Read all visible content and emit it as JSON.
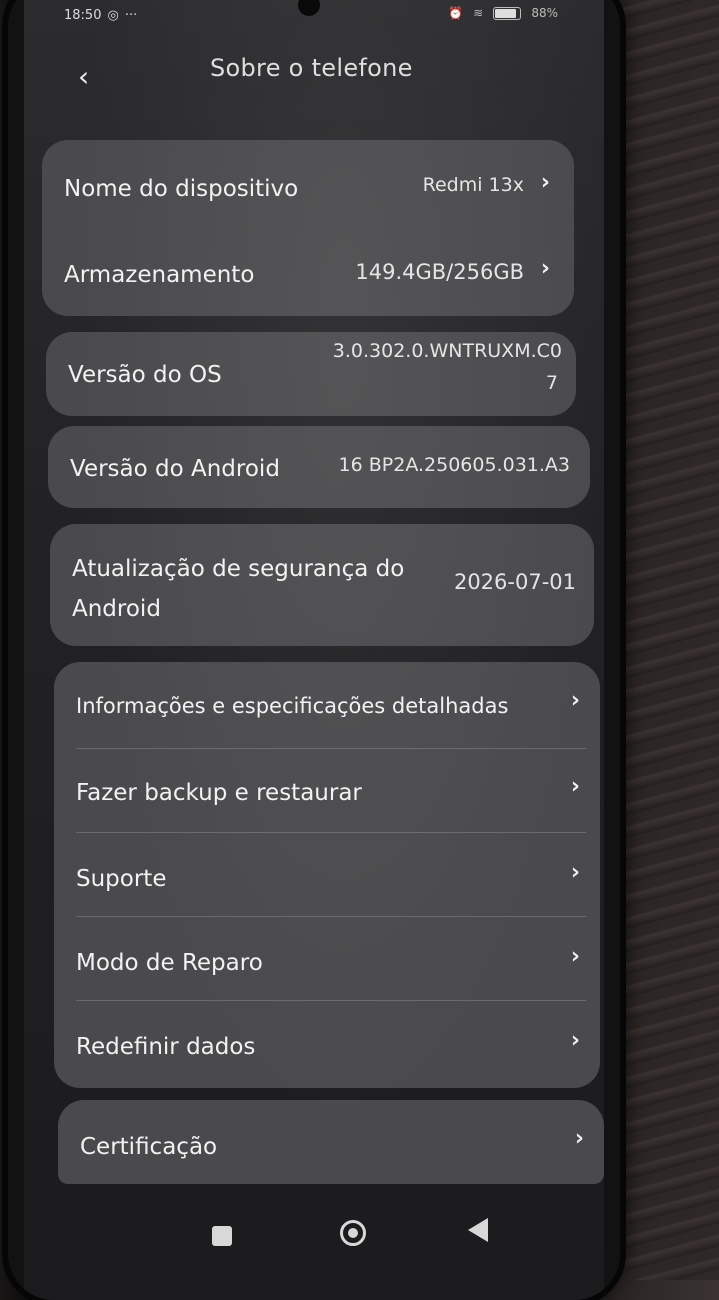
{
  "status": {
    "time": "18:50",
    "battery": "88%"
  },
  "header": {
    "back_icon": "chevron-left-icon",
    "title": "Sobre o telefone"
  },
  "device_card": {
    "name_label": "Nome do dispositivo",
    "name_value": "Redmi 13x",
    "storage_label": "Armazenamento",
    "storage_value": "149.4GB/256GB"
  },
  "os_card": {
    "label": "Versão do OS",
    "value_line1": "3.0.302.0.WNTRUXM.C0",
    "value_line2": "7"
  },
  "android_card": {
    "label": "Versão do Android",
    "value": "16 BP2A.250605.031.A3"
  },
  "security_card": {
    "label_line1": "Atualização de segurança do",
    "label_line2": "Android",
    "value": "2026-07-01"
  },
  "menu": {
    "items": [
      {
        "label": "Informações e especificações detalhadas"
      },
      {
        "label": "Fazer backup e restaurar"
      },
      {
        "label": "Suporte"
      },
      {
        "label": "Modo de Reparo"
      },
      {
        "label": "Redefinir dados"
      }
    ]
  },
  "cert": {
    "label": "Certificação"
  },
  "colors": {
    "card": "#4a4a4c",
    "screen": "#222224",
    "text": "#f2f2f2"
  }
}
